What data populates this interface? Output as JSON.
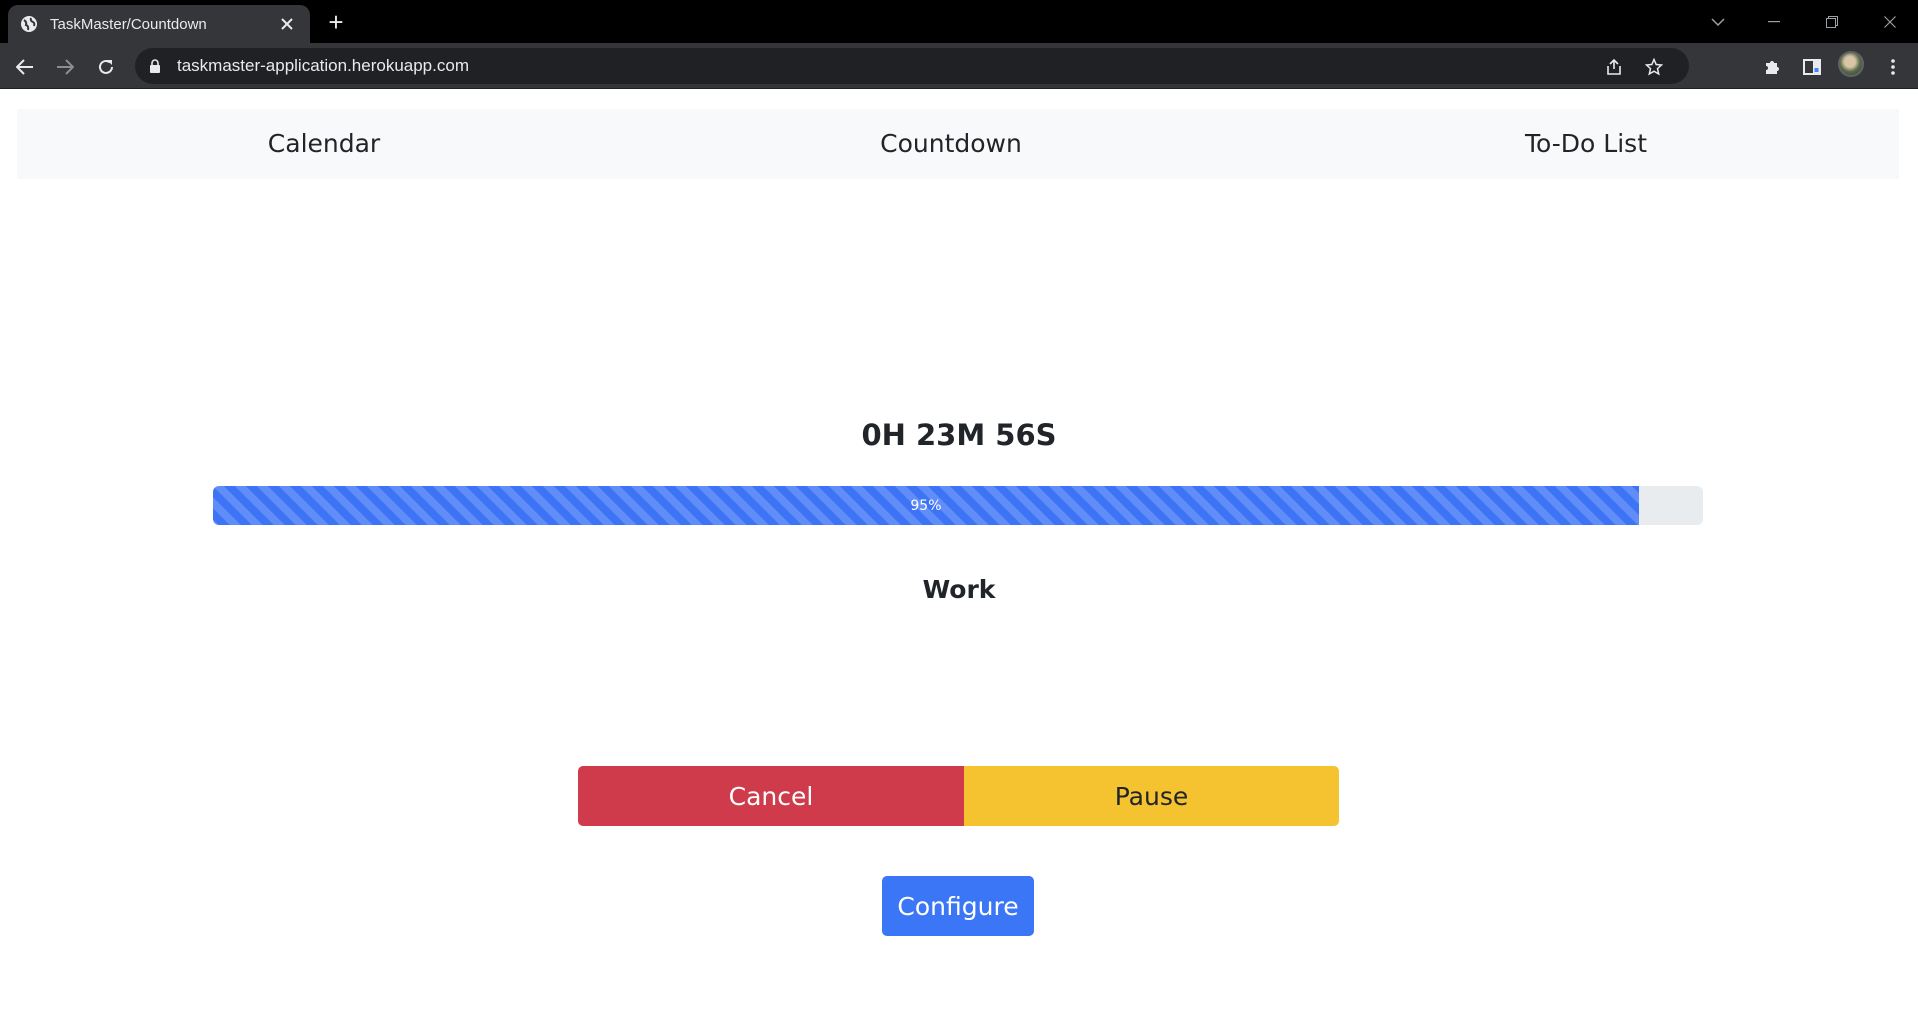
{
  "browser": {
    "tab_title": "TaskMaster/Countdown",
    "new_tab_label": "+",
    "url": "taskmaster-application.herokuapp.com",
    "icons": {
      "favicon": "globe-icon",
      "tab_close": "close-icon",
      "back": "back-arrow-icon",
      "forward": "forward-arrow-icon",
      "reload": "reload-icon",
      "lock": "lock-icon",
      "share": "share-icon",
      "bookmark": "star-icon",
      "extensions": "puzzle-icon",
      "side_panel": "side-panel-icon",
      "menu": "kebab-menu-icon",
      "tab_search": "chevron-down-icon",
      "minimize": "minimize-icon",
      "restore": "restore-icon",
      "close_window": "close-icon"
    }
  },
  "nav": {
    "items": [
      {
        "label": "Calendar"
      },
      {
        "label": "Countdown"
      },
      {
        "label": "To-Do List"
      }
    ]
  },
  "countdown": {
    "time": "0H 23M 56S",
    "progress_value": 95.7,
    "progress_label": "95%",
    "mode": "Work"
  },
  "buttons": {
    "cancel": "Cancel",
    "pause": "Pause",
    "configure": "Configure"
  },
  "colors": {
    "progress": "#3d74f5",
    "progress_track": "#e9ecef",
    "cancel": "#d03b4b",
    "pause": "#f5c230",
    "configure": "#3a76f5",
    "navbar": "#f8f9fa"
  }
}
